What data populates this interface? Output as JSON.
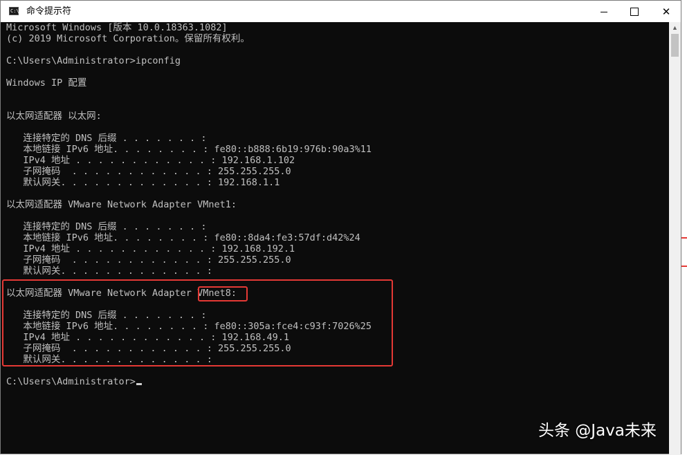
{
  "window": {
    "title": "命令提示符",
    "icon": "console-app-icon",
    "controls": {
      "minimize": "minimize-icon",
      "maximize": "maximize-icon",
      "close": "close-icon"
    }
  },
  "colors": {
    "console_bg": "#0c0c0c",
    "console_text": "#c0c0c0",
    "highlight": "#e53935"
  },
  "console": {
    "lines": [
      "Microsoft Windows [版本 10.0.18363.1082]",
      "(c) 2019 Microsoft Corporation。保留所有权利。",
      "",
      "C:\\Users\\Administrator>ipconfig",
      "",
      "Windows IP 配置",
      "",
      "",
      "以太网适配器 以太网:",
      "",
      "   连接特定的 DNS 后缀 . . . . . . . :",
      "   本地链接 IPv6 地址. . . . . . . . : fe80::b888:6b19:976b:90a3%11",
      "   IPv4 地址 . . . . . . . . . . . . : 192.168.1.102",
      "   子网掩码  . . . . . . . . . . . . : 255.255.255.0",
      "   默认网关. . . . . . . . . . . . . : 192.168.1.1",
      "",
      "以太网适配器 VMware Network Adapter VMnet1:",
      "",
      "   连接特定的 DNS 后缀 . . . . . . . :",
      "   本地链接 IPv6 地址. . . . . . . . : fe80::8da4:fe3:57df:d42%24",
      "   IPv4 地址 . . . . . . . . . . . . : 192.168.192.1",
      "   子网掩码  . . . . . . . . . . . . : 255.255.255.0",
      "   默认网关. . . . . . . . . . . . . :",
      "",
      "以太网适配器 VMware Network Adapter VMnet8:",
      "",
      "   连接特定的 DNS 后缀 . . . . . . . :",
      "   本地链接 IPv6 地址. . . . . . . . : fe80::305a:fce4:c93f:7026%25",
      "   IPv4 地址 . . . . . . . . . . . . : 192.168.49.1",
      "   子网掩码  . . . . . . . . . . . . : 255.255.255.0",
      "   默认网关. . . . . . . . . . . . . :",
      "",
      "C:\\Users\\Administrator>"
    ]
  },
  "scrollbar": {
    "up_arrow": "scroll-up-arrow-icon"
  },
  "watermark": "头条 @Java未来"
}
